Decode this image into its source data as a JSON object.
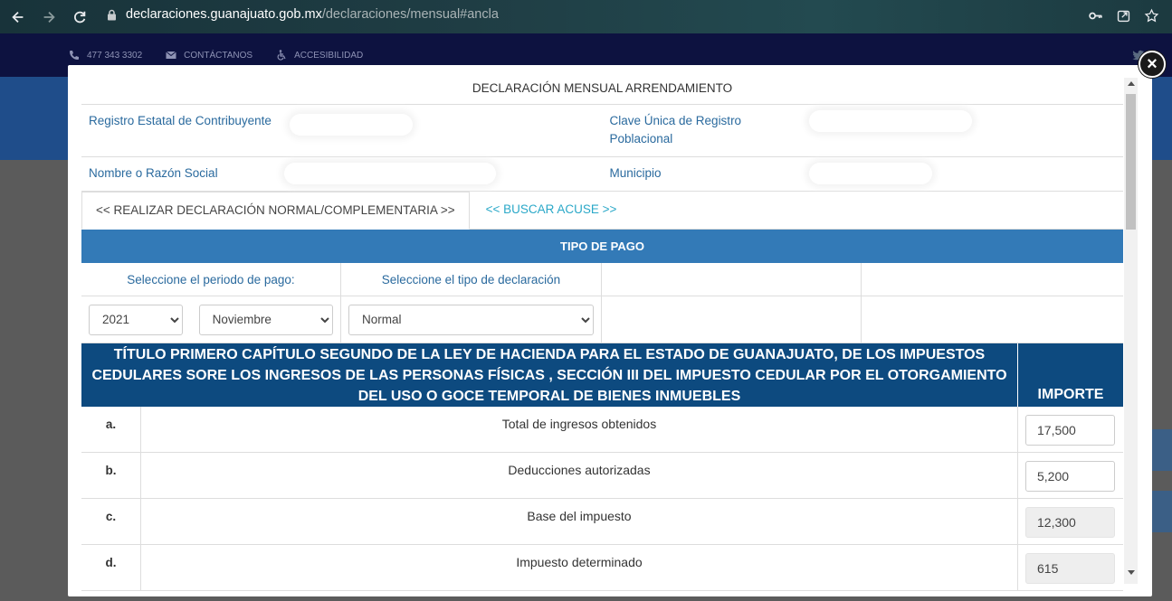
{
  "browser": {
    "url_host": "declaraciones.guanajuato.gob.mx",
    "url_path": "/declaraciones/mensual#ancla"
  },
  "site": {
    "phone": "477 343 3302",
    "contact": "CONTÁCTANOS",
    "accessibility": "ACCESIBILIDAD"
  },
  "modal": {
    "close": "×",
    "title": "DECLARACIÓN MENSUAL ARRENDAMIENTO",
    "rec_label": "Registro Estatal de Contribuyente",
    "curp_label": "Clave Única de Registro Poblacional",
    "name_label": "Nombre o Razón Social",
    "municipio_label": "Municipio",
    "tabs": [
      {
        "label": "<< REALIZAR DECLARACIÓN NORMAL/COMPLEMENTARIA >>"
      },
      {
        "label": "<< BUSCAR ACUSE >>"
      }
    ],
    "pago": {
      "header": "TIPO DE PAGO",
      "periodo_label": "Seleccione el periodo de pago:",
      "tipo_label": "Seleccione el tipo de declaración",
      "year": "2021",
      "month": "Noviembre",
      "tipo": "Normal"
    },
    "law_header": "TÍTULO PRIMERO CAPÍTULO SEGUNDO DE LA LEY DE HACIENDA PARA EL ESTADO DE GUANAJUATO, DE LOS IMPUESTOS CEDULARES SORE LOS INGRESOS DE LAS PERSONAS FÍSICAS , SECCIÓN III DEL IMPUESTO CEDULAR POR EL OTORGAMIENTO DEL USO O GOCE TEMPORAL DE BIENES INMUEBLES",
    "importe_header": "IMPORTE",
    "rows": [
      {
        "letter": "a.",
        "concept": "Total de ingresos obtenidos",
        "amount": "17,500"
      },
      {
        "letter": "b.",
        "concept": "Deducciones autorizadas",
        "amount": "5,200"
      },
      {
        "letter": "c.",
        "concept": "Base del impuesto",
        "amount": "12,300"
      },
      {
        "letter": "d.",
        "concept": "Impuesto determinado",
        "amount": "615"
      }
    ]
  },
  "colors": {
    "table_header_blue": "#337ab7",
    "law_header_navy": "#0d4a7f",
    "label_blue": "#2a6a9e",
    "link_cyan": "#2aa8c8"
  }
}
